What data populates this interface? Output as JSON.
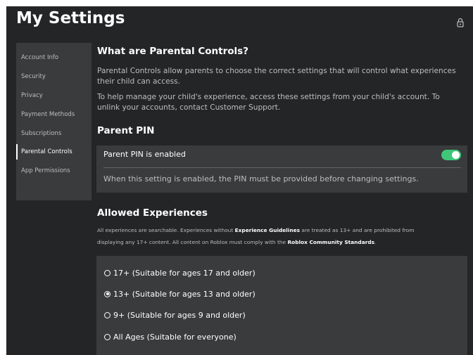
{
  "page": {
    "title": "My Settings"
  },
  "sidebar": {
    "items": [
      {
        "label": "Account Info"
      },
      {
        "label": "Security"
      },
      {
        "label": "Privacy"
      },
      {
        "label": "Payment Methods"
      },
      {
        "label": "Subscriptions"
      },
      {
        "label": "Parental Controls",
        "active": true
      },
      {
        "label": "App Permissions"
      }
    ]
  },
  "parental": {
    "heading": "What are Parental Controls?",
    "para1": "Parental Controls allow parents to choose the correct settings that will control what experiences their child can access.",
    "para2": "To help manage your child's experience, access these settings from your child's account. To unlink your accounts, contact Customer Support."
  },
  "pin": {
    "heading": "Parent PIN",
    "label": "Parent PIN is enabled",
    "enabled": true,
    "description": "When this setting is enabled, the PIN must be provided before changing settings."
  },
  "allowed": {
    "heading": "Allowed Experiences",
    "line1_pre": "All experiences are searchable. Experiences without ",
    "line1_link": "Experience Guidelines",
    "line1_post": " are treated as 13+ and are prohibited from",
    "line2_pre": "displaying any 17+ content. All content on Roblox must comply with the ",
    "line2_link": "Roblox Community Standards",
    "line2_post": ".",
    "options": [
      {
        "label": "17+ (Suitable for ages 17 and older)",
        "selected": false
      },
      {
        "label": "13+ (Suitable for ages 13 and older)",
        "selected": true
      },
      {
        "label": "9+ (Suitable for ages 9 and older)",
        "selected": false
      },
      {
        "label": "All Ages (Suitable for everyone)",
        "selected": false
      }
    ]
  },
  "colors": {
    "background": "#232527",
    "panel": "#393b3d",
    "toggle_on": "#3fc679"
  },
  "icons": {
    "header": "lock-icon"
  }
}
